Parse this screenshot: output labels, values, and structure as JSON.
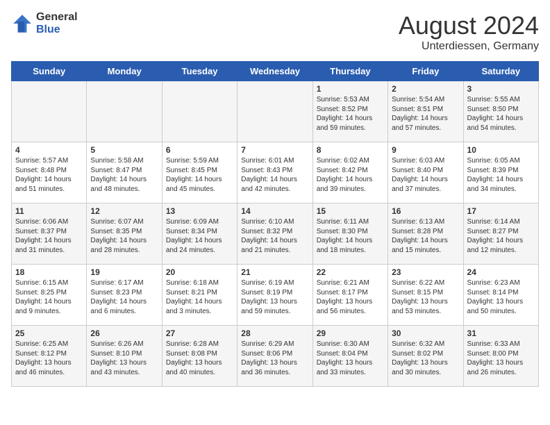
{
  "header": {
    "logo_general": "General",
    "logo_blue": "Blue",
    "month_year": "August 2024",
    "location": "Unterdiessen, Germany"
  },
  "days_of_week": [
    "Sunday",
    "Monday",
    "Tuesday",
    "Wednesday",
    "Thursday",
    "Friday",
    "Saturday"
  ],
  "weeks": [
    [
      {
        "num": "",
        "info": ""
      },
      {
        "num": "",
        "info": ""
      },
      {
        "num": "",
        "info": ""
      },
      {
        "num": "",
        "info": ""
      },
      {
        "num": "1",
        "info": "Sunrise: 5:53 AM\nSunset: 8:52 PM\nDaylight: 14 hours\nand 59 minutes."
      },
      {
        "num": "2",
        "info": "Sunrise: 5:54 AM\nSunset: 8:51 PM\nDaylight: 14 hours\nand 57 minutes."
      },
      {
        "num": "3",
        "info": "Sunrise: 5:55 AM\nSunset: 8:50 PM\nDaylight: 14 hours\nand 54 minutes."
      }
    ],
    [
      {
        "num": "4",
        "info": "Sunrise: 5:57 AM\nSunset: 8:48 PM\nDaylight: 14 hours\nand 51 minutes."
      },
      {
        "num": "5",
        "info": "Sunrise: 5:58 AM\nSunset: 8:47 PM\nDaylight: 14 hours\nand 48 minutes."
      },
      {
        "num": "6",
        "info": "Sunrise: 5:59 AM\nSunset: 8:45 PM\nDaylight: 14 hours\nand 45 minutes."
      },
      {
        "num": "7",
        "info": "Sunrise: 6:01 AM\nSunset: 8:43 PM\nDaylight: 14 hours\nand 42 minutes."
      },
      {
        "num": "8",
        "info": "Sunrise: 6:02 AM\nSunset: 8:42 PM\nDaylight: 14 hours\nand 39 minutes."
      },
      {
        "num": "9",
        "info": "Sunrise: 6:03 AM\nSunset: 8:40 PM\nDaylight: 14 hours\nand 37 minutes."
      },
      {
        "num": "10",
        "info": "Sunrise: 6:05 AM\nSunset: 8:39 PM\nDaylight: 14 hours\nand 34 minutes."
      }
    ],
    [
      {
        "num": "11",
        "info": "Sunrise: 6:06 AM\nSunset: 8:37 PM\nDaylight: 14 hours\nand 31 minutes."
      },
      {
        "num": "12",
        "info": "Sunrise: 6:07 AM\nSunset: 8:35 PM\nDaylight: 14 hours\nand 28 minutes."
      },
      {
        "num": "13",
        "info": "Sunrise: 6:09 AM\nSunset: 8:34 PM\nDaylight: 14 hours\nand 24 minutes."
      },
      {
        "num": "14",
        "info": "Sunrise: 6:10 AM\nSunset: 8:32 PM\nDaylight: 14 hours\nand 21 minutes."
      },
      {
        "num": "15",
        "info": "Sunrise: 6:11 AM\nSunset: 8:30 PM\nDaylight: 14 hours\nand 18 minutes."
      },
      {
        "num": "16",
        "info": "Sunrise: 6:13 AM\nSunset: 8:28 PM\nDaylight: 14 hours\nand 15 minutes."
      },
      {
        "num": "17",
        "info": "Sunrise: 6:14 AM\nSunset: 8:27 PM\nDaylight: 14 hours\nand 12 minutes."
      }
    ],
    [
      {
        "num": "18",
        "info": "Sunrise: 6:15 AM\nSunset: 8:25 PM\nDaylight: 14 hours\nand 9 minutes."
      },
      {
        "num": "19",
        "info": "Sunrise: 6:17 AM\nSunset: 8:23 PM\nDaylight: 14 hours\nand 6 minutes."
      },
      {
        "num": "20",
        "info": "Sunrise: 6:18 AM\nSunset: 8:21 PM\nDaylight: 14 hours\nand 3 minutes."
      },
      {
        "num": "21",
        "info": "Sunrise: 6:19 AM\nSunset: 8:19 PM\nDaylight: 13 hours\nand 59 minutes."
      },
      {
        "num": "22",
        "info": "Sunrise: 6:21 AM\nSunset: 8:17 PM\nDaylight: 13 hours\nand 56 minutes."
      },
      {
        "num": "23",
        "info": "Sunrise: 6:22 AM\nSunset: 8:15 PM\nDaylight: 13 hours\nand 53 minutes."
      },
      {
        "num": "24",
        "info": "Sunrise: 6:23 AM\nSunset: 8:14 PM\nDaylight: 13 hours\nand 50 minutes."
      }
    ],
    [
      {
        "num": "25",
        "info": "Sunrise: 6:25 AM\nSunset: 8:12 PM\nDaylight: 13 hours\nand 46 minutes."
      },
      {
        "num": "26",
        "info": "Sunrise: 6:26 AM\nSunset: 8:10 PM\nDaylight: 13 hours\nand 43 minutes."
      },
      {
        "num": "27",
        "info": "Sunrise: 6:28 AM\nSunset: 8:08 PM\nDaylight: 13 hours\nand 40 minutes."
      },
      {
        "num": "28",
        "info": "Sunrise: 6:29 AM\nSunset: 8:06 PM\nDaylight: 13 hours\nand 36 minutes."
      },
      {
        "num": "29",
        "info": "Sunrise: 6:30 AM\nSunset: 8:04 PM\nDaylight: 13 hours\nand 33 minutes."
      },
      {
        "num": "30",
        "info": "Sunrise: 6:32 AM\nSunset: 8:02 PM\nDaylight: 13 hours\nand 30 minutes."
      },
      {
        "num": "31",
        "info": "Sunrise: 6:33 AM\nSunset: 8:00 PM\nDaylight: 13 hours\nand 26 minutes."
      }
    ]
  ]
}
